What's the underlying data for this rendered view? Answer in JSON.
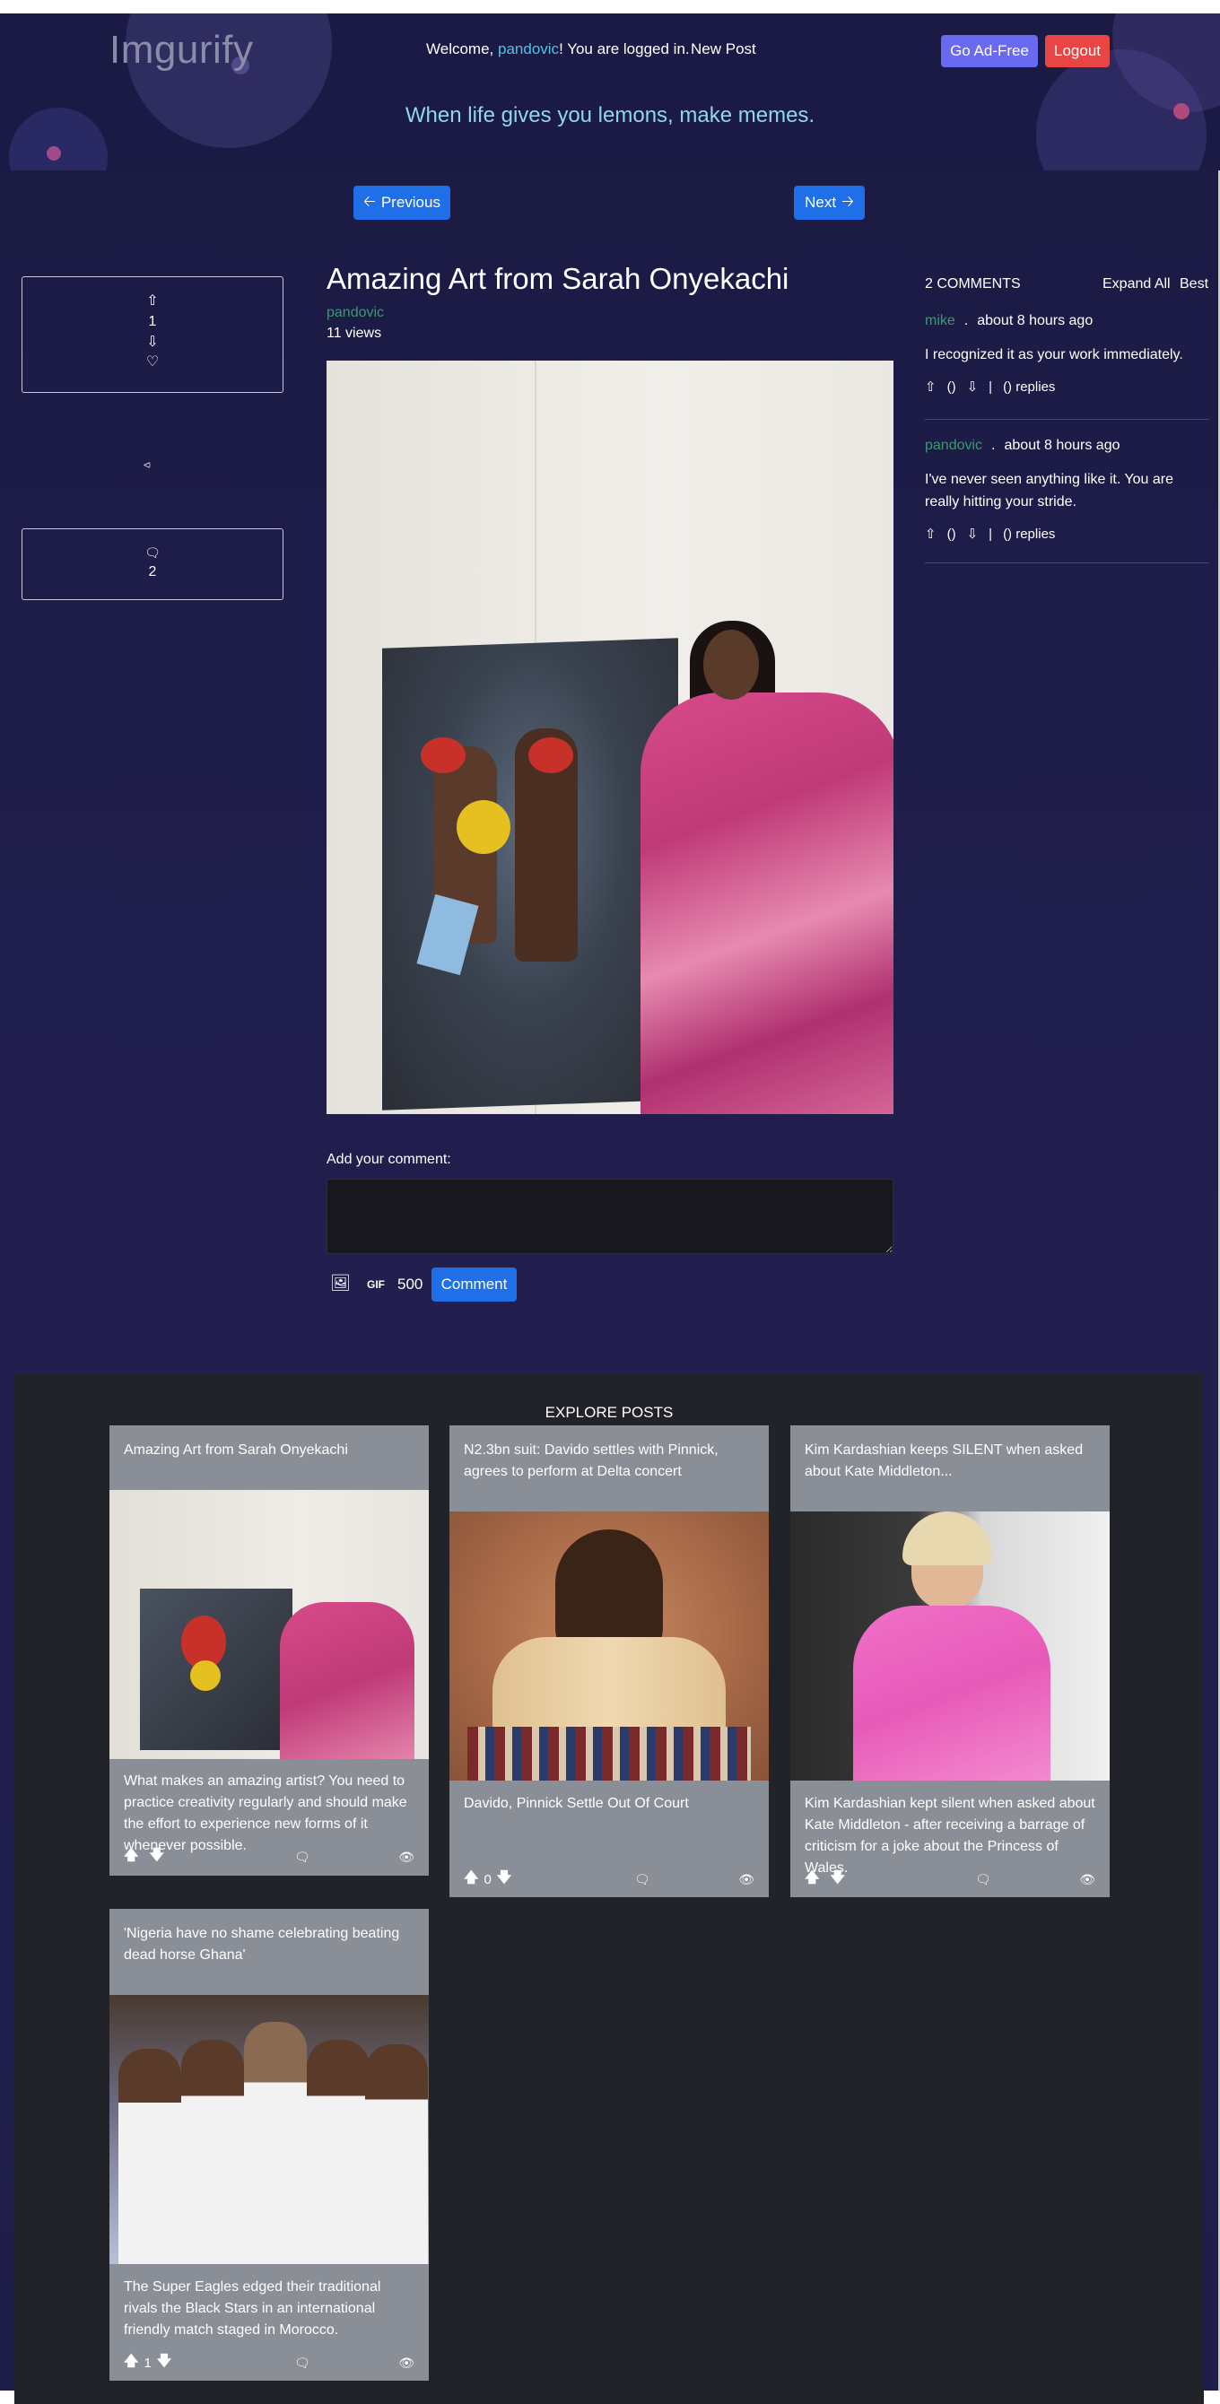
{
  "header": {
    "logo": "Imgurify",
    "welcome_prefix": "Welcome,",
    "username": "pandovic",
    "welcome_suffix": "! You are logged in.",
    "new_post": "New Post",
    "ad_free": "Go Ad-Free",
    "logout": "Logout",
    "tagline": "When life gives you lemons, make memes."
  },
  "nav": {
    "previous": "Previous",
    "next": "Next"
  },
  "post": {
    "title": "Amazing Art from Sarah Onyekachi",
    "author": "pandovic",
    "views": "11 views",
    "votes": "1",
    "comment_count": "2"
  },
  "comment_form": {
    "label": "Add your comment:",
    "input_value": "",
    "gif_label": "GIF",
    "char_limit": "500",
    "submit": "Comment"
  },
  "comments": {
    "header": "2 COMMENTS",
    "expand_all": "Expand All",
    "sort": "Best",
    "items": [
      {
        "author": "mike",
        "time": "about 8 hours ago",
        "text": "I recognized it as your work immediately.",
        "upvotes": "()",
        "replies": "() replies"
      },
      {
        "author": "pandovic",
        "time": "about 8 hours ago",
        "text": "I've never seen anything like it. You are really hitting your stride.",
        "upvotes": "()",
        "replies": "() replies"
      }
    ]
  },
  "explore": {
    "title": "EXPLORE POSTS",
    "cards": [
      {
        "title": "Amazing Art from Sarah Onyekachi",
        "description": "What makes an amazing artist? You need to practice creativity regularly and should make the effort to experience new forms of it whenever possible.",
        "score": ""
      },
      {
        "title": "N2.3bn suit: Davido settles with Pinnick, agrees to perform at Delta concert",
        "description": "Davido, Pinnick Settle Out Of Court",
        "score": "0"
      },
      {
        "title": "Kim Kardashian keeps SILENT when asked about Kate Middleton...",
        "description": "Kim Kardashian kept silent when asked about Kate Middleton - after receiving a barrage of criticism for a joke about the Princess of Wales.",
        "score": ""
      },
      {
        "title": "'Nigeria have no shame celebrating beating dead horse Ghana'",
        "description": "The Super Eagles edged their traditional rivals the Black Stars in an international friendly match staged in Morocco.",
        "score": "1"
      }
    ]
  },
  "colors": {
    "primary_button": "#1e6fe8",
    "ad_free_button": "#6a6af0",
    "logout_button": "#e84545",
    "author_link": "#3a9a6e",
    "username_link": "#4fc3e8",
    "tagline": "#8fd6f0",
    "background": "#1f1d4a",
    "explore_background": "#212328",
    "card_background": "#8a8e96"
  },
  "icons": [
    "arrow-up-outline",
    "arrow-down-outline",
    "heart-outline",
    "share-nodes",
    "speech-bubble",
    "image",
    "arrow-left",
    "arrow-right",
    "eye",
    "arrow-up-solid",
    "arrow-down-solid"
  ]
}
